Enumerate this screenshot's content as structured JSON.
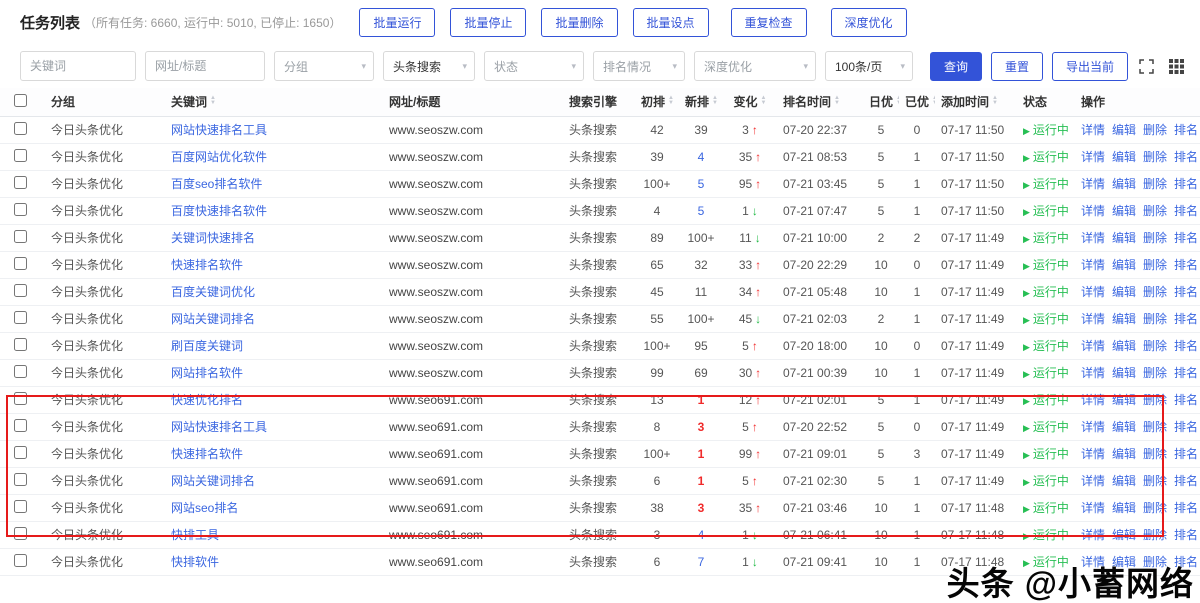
{
  "header": {
    "title": "任务列表",
    "stats": "（所有任务: 6660, 运行中: 5010, 已停止: 1650）",
    "buttons": [
      "批量运行",
      "批量停止",
      "批量删除",
      "批量设点",
      "重复检查",
      "深度优化"
    ]
  },
  "filters": {
    "keyword_placeholder": "关键词",
    "url_placeholder": "网址/标题",
    "group": "分组",
    "engine": "头条搜索",
    "status": "状态",
    "rank": "排名情况",
    "deep": "深度优化",
    "page_size": "100条/页",
    "query_label": "查询",
    "reset_label": "重置",
    "export_label": "导出当前"
  },
  "icons": {
    "chevron": "▾",
    "sort_up": "▲",
    "sort_down": "▼",
    "play": "▶",
    "arrow_up": "↑",
    "arrow_down": "↓"
  },
  "colors": {
    "accent": "#3353d8",
    "link": "#3a66e0",
    "up": "#f02b2b",
    "down": "#21ba45",
    "running": "#27bf54",
    "highlight": "#e61a1a"
  },
  "table": {
    "columns": [
      {
        "label": "分组",
        "sortable": false
      },
      {
        "label": "关键词",
        "sortable": true
      },
      {
        "label": "网址/标题",
        "sortable": false
      },
      {
        "label": "搜索引擎",
        "sortable": false
      },
      {
        "label": "初排",
        "sortable": true
      },
      {
        "label": "新排",
        "sortable": true
      },
      {
        "label": "变化",
        "sortable": true
      },
      {
        "label": "排名时间",
        "sortable": true
      },
      {
        "label": "日优",
        "sortable": true
      },
      {
        "label": "已优",
        "sortable": true
      },
      {
        "label": "添加时间",
        "sortable": true
      },
      {
        "label": "状态",
        "sortable": false
      },
      {
        "label": "操作",
        "sortable": false
      }
    ],
    "actions": [
      "详情",
      "编辑",
      "删除",
      "排名"
    ],
    "status_running": "运行中",
    "highlight": {
      "from": 10,
      "to": 14
    },
    "rows": [
      {
        "group": "今日头条优化",
        "keyword": "网站快速排名工具",
        "url": "www.seoszw.com",
        "engine": "头条搜索",
        "init": "42",
        "new": "39",
        "new_color": "dark",
        "change": "3",
        "dir": "up",
        "rank_time": "07-20 22:37",
        "daily": "5",
        "done": "0",
        "add_time": "07-17 11:50"
      },
      {
        "group": "今日头条优化",
        "keyword": "百度网站优化软件",
        "url": "www.seoszw.com",
        "engine": "头条搜索",
        "init": "39",
        "new": "4",
        "new_color": "blue",
        "change": "35",
        "dir": "up",
        "rank_time": "07-21 08:53",
        "daily": "5",
        "done": "1",
        "add_time": "07-17 11:50"
      },
      {
        "group": "今日头条优化",
        "keyword": "百度seo排名软件",
        "url": "www.seoszw.com",
        "engine": "头条搜索",
        "init": "100+",
        "new": "5",
        "new_color": "blue",
        "change": "95",
        "dir": "up",
        "rank_time": "07-21 03:45",
        "daily": "5",
        "done": "1",
        "add_time": "07-17 11:50"
      },
      {
        "group": "今日头条优化",
        "keyword": "百度快速排名软件",
        "url": "www.seoszw.com",
        "engine": "头条搜索",
        "init": "4",
        "new": "5",
        "new_color": "blue",
        "change": "1",
        "dir": "down",
        "rank_time": "07-21 07:47",
        "daily": "5",
        "done": "1",
        "add_time": "07-17 11:50"
      },
      {
        "group": "今日头条优化",
        "keyword": "关键词快速排名",
        "url": "www.seoszw.com",
        "engine": "头条搜索",
        "init": "89",
        "new": "100+",
        "new_color": "dark",
        "change": "11",
        "dir": "down",
        "rank_time": "07-21 10:00",
        "daily": "2",
        "done": "2",
        "add_time": "07-17 11:49"
      },
      {
        "group": "今日头条优化",
        "keyword": "快速排名软件",
        "url": "www.seoszw.com",
        "engine": "头条搜索",
        "init": "65",
        "new": "32",
        "new_color": "dark",
        "change": "33",
        "dir": "up",
        "rank_time": "07-20 22:29",
        "daily": "10",
        "done": "0",
        "add_time": "07-17 11:49"
      },
      {
        "group": "今日头条优化",
        "keyword": "百度关键词优化",
        "url": "www.seoszw.com",
        "engine": "头条搜索",
        "init": "45",
        "new": "11",
        "new_color": "dark",
        "change": "34",
        "dir": "up",
        "rank_time": "07-21 05:48",
        "daily": "10",
        "done": "1",
        "add_time": "07-17 11:49"
      },
      {
        "group": "今日头条优化",
        "keyword": "网站关键词排名",
        "url": "www.seoszw.com",
        "engine": "头条搜索",
        "init": "55",
        "new": "100+",
        "new_color": "dark",
        "change": "45",
        "dir": "down",
        "rank_time": "07-21 02:03",
        "daily": "2",
        "done": "1",
        "add_time": "07-17 11:49"
      },
      {
        "group": "今日头条优化",
        "keyword": "刷百度关键词",
        "url": "www.seoszw.com",
        "engine": "头条搜索",
        "init": "100+",
        "new": "95",
        "new_color": "dark",
        "change": "5",
        "dir": "up",
        "rank_time": "07-20 18:00",
        "daily": "10",
        "done": "0",
        "add_time": "07-17 11:49"
      },
      {
        "group": "今日头条优化",
        "keyword": "网站排名软件",
        "url": "www.seoszw.com",
        "engine": "头条搜索",
        "init": "99",
        "new": "69",
        "new_color": "dark",
        "change": "30",
        "dir": "up",
        "rank_time": "07-21 00:39",
        "daily": "10",
        "done": "1",
        "add_time": "07-17 11:49"
      },
      {
        "group": "今日头条优化",
        "keyword": "快速优化排名",
        "url": "www.seo691.com",
        "engine": "头条搜索",
        "init": "13",
        "new": "1",
        "new_color": "red",
        "change": "12",
        "dir": "up",
        "rank_time": "07-21 02:01",
        "daily": "5",
        "done": "1",
        "add_time": "07-17 11:49"
      },
      {
        "group": "今日头条优化",
        "keyword": "网站快速排名工具",
        "url": "www.seo691.com",
        "engine": "头条搜索",
        "init": "8",
        "new": "3",
        "new_color": "red",
        "change": "5",
        "dir": "up",
        "rank_time": "07-20 22:52",
        "daily": "5",
        "done": "0",
        "add_time": "07-17 11:49"
      },
      {
        "group": "今日头条优化",
        "keyword": "快速排名软件",
        "url": "www.seo691.com",
        "engine": "头条搜索",
        "init": "100+",
        "new": "1",
        "new_color": "red",
        "change": "99",
        "dir": "up",
        "rank_time": "07-21 09:01",
        "daily": "5",
        "done": "3",
        "add_time": "07-17 11:49"
      },
      {
        "group": "今日头条优化",
        "keyword": "网站关键词排名",
        "url": "www.seo691.com",
        "engine": "头条搜索",
        "init": "6",
        "new": "1",
        "new_color": "red",
        "change": "5",
        "dir": "up",
        "rank_time": "07-21 02:30",
        "daily": "5",
        "done": "1",
        "add_time": "07-17 11:49"
      },
      {
        "group": "今日头条优化",
        "keyword": "网站seo排名",
        "url": "www.seo691.com",
        "engine": "头条搜索",
        "init": "38",
        "new": "3",
        "new_color": "red",
        "change": "35",
        "dir": "up",
        "rank_time": "07-21 03:46",
        "daily": "10",
        "done": "1",
        "add_time": "07-17 11:48"
      },
      {
        "group": "今日头条优化",
        "keyword": "快排工具",
        "url": "www.seo691.com",
        "engine": "头条搜索",
        "init": "3",
        "new": "4",
        "new_color": "blue",
        "change": "1",
        "dir": "down",
        "rank_time": "07-21 06:41",
        "daily": "10",
        "done": "1",
        "add_time": "07-17 11:48"
      },
      {
        "group": "今日头条优化",
        "keyword": "快排软件",
        "url": "www.seo691.com",
        "engine": "头条搜索",
        "init": "6",
        "new": "7",
        "new_color": "blue",
        "change": "1",
        "dir": "down",
        "rank_time": "07-21 09:41",
        "daily": "10",
        "done": "1",
        "add_time": "07-17 11:48"
      }
    ]
  },
  "watermark": "头条 @小蓄网络"
}
